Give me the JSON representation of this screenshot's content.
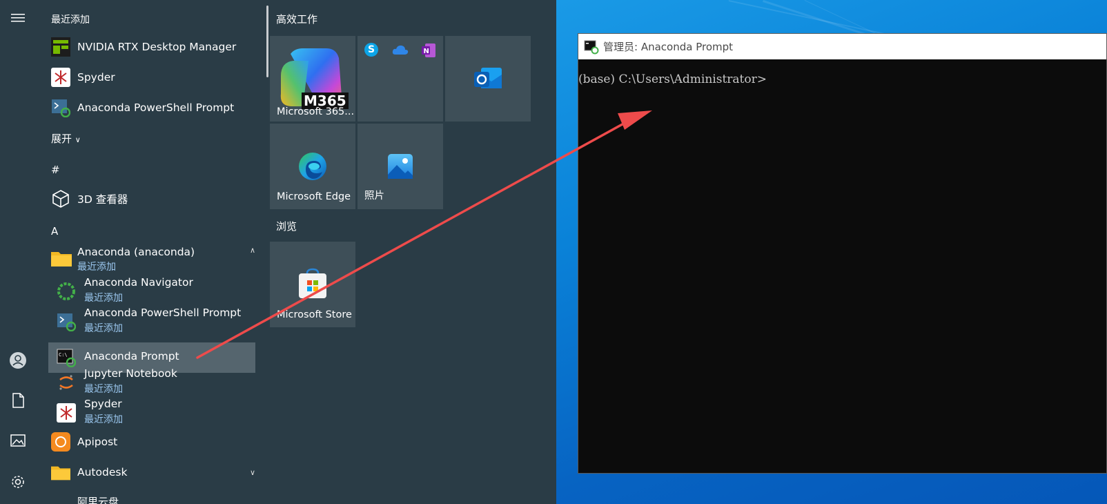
{
  "start_menu": {
    "recent_header": "最近添加",
    "recent_apps": [
      {
        "label": "NVIDIA RTX Desktop Manager"
      },
      {
        "label": "Spyder"
      },
      {
        "label": "Anaconda PowerShell Prompt"
      }
    ],
    "expand_label": "展开",
    "hash_header": "#",
    "viewer_label": "3D 查看器",
    "a_header": "A",
    "anaconda_folder": {
      "label": "Anaconda (anaconda)",
      "recent": "最近添加"
    },
    "anaconda_items": [
      {
        "label": "Anaconda Navigator",
        "recent": "最近添加"
      },
      {
        "label": "Anaconda PowerShell Prompt",
        "recent": "最近添加"
      },
      {
        "label": "Anaconda Prompt",
        "recent": ""
      },
      {
        "label": "Jupyter Notebook",
        "recent": "最近添加"
      },
      {
        "label": "Spyder",
        "recent": "最近添加"
      }
    ],
    "apipost_label": "Apipost",
    "autodesk_label": "Autodesk",
    "partial_label": "阿里云盘"
  },
  "tiles": {
    "productivity_header": "高效工作",
    "m365_label": "Microsoft 365...",
    "m365_badge": "M365",
    "edge_label": "Microsoft Edge",
    "photos_label": "照片",
    "browse_header": "浏览",
    "store_label": "Microsoft Store"
  },
  "console": {
    "title": "管理员: Anaconda Prompt",
    "prompt_line": "(base) C:\\Users\\Administrator>"
  },
  "colors": {
    "start_bg": "#2a3c46",
    "tile_bg": "#3e4f58",
    "recent_blue": "#9bc7ef",
    "arrow_red": "#ee4b4b"
  }
}
